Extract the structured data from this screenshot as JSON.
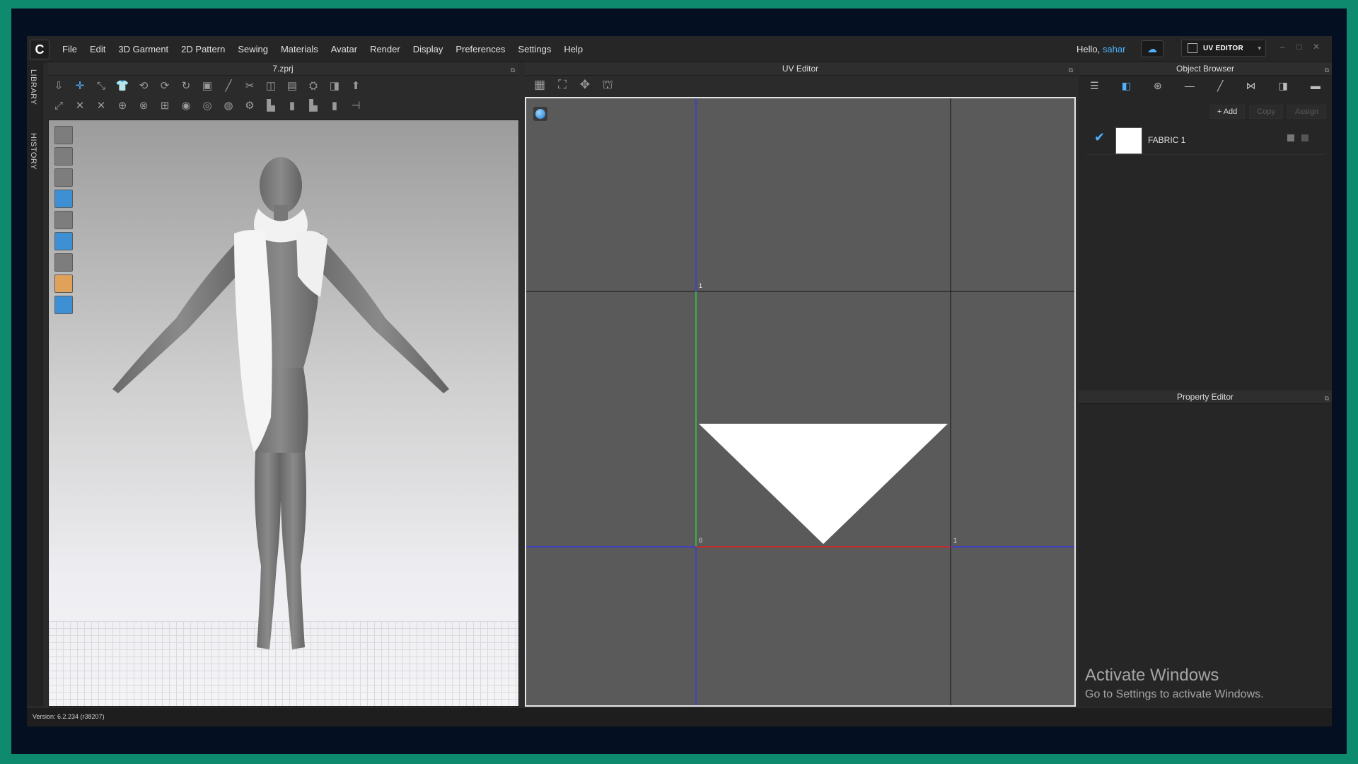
{
  "app": {
    "logo": "C",
    "menu": [
      "File",
      "Edit",
      "3D Garment",
      "2D Pattern",
      "Sewing",
      "Materials",
      "Avatar",
      "Render",
      "Display",
      "Preferences",
      "Settings",
      "Help"
    ],
    "greeting": "Hello,",
    "username": "sahar",
    "mode_label": "UV EDITOR",
    "window_controls": [
      "minimize-icon",
      "maximize-icon",
      "close-icon"
    ]
  },
  "sidetabs": [
    "LIBRARY",
    "HISTORY"
  ],
  "viewport3d": {
    "file_title": "7.zprj"
  },
  "uv_editor": {
    "title": "UV Editor",
    "labels": {
      "top": "1",
      "origin": "0",
      "right": "1"
    }
  },
  "object_browser": {
    "title": "Object Browser",
    "add_label": "+ Add",
    "copy_label": "Copy",
    "assign_label": "Assign",
    "fabric": {
      "name": "FABRIC 1",
      "checked": true,
      "swatch_color": "#ffffff"
    }
  },
  "property_editor": {
    "title": "Property Editor"
  },
  "watermark": {
    "line1": "Activate Windows",
    "line2": "Go to Settings to activate Windows."
  },
  "status": {
    "version": "Version: 6.2.234 (r38207)"
  },
  "colors": {
    "accent": "#4fb2ff",
    "frame": "#0e8a6e",
    "uv_axis_v_blue": "#3b3bdc",
    "uv_axis_v_green": "#2ecc40",
    "uv_axis_h_red": "#e02020"
  }
}
